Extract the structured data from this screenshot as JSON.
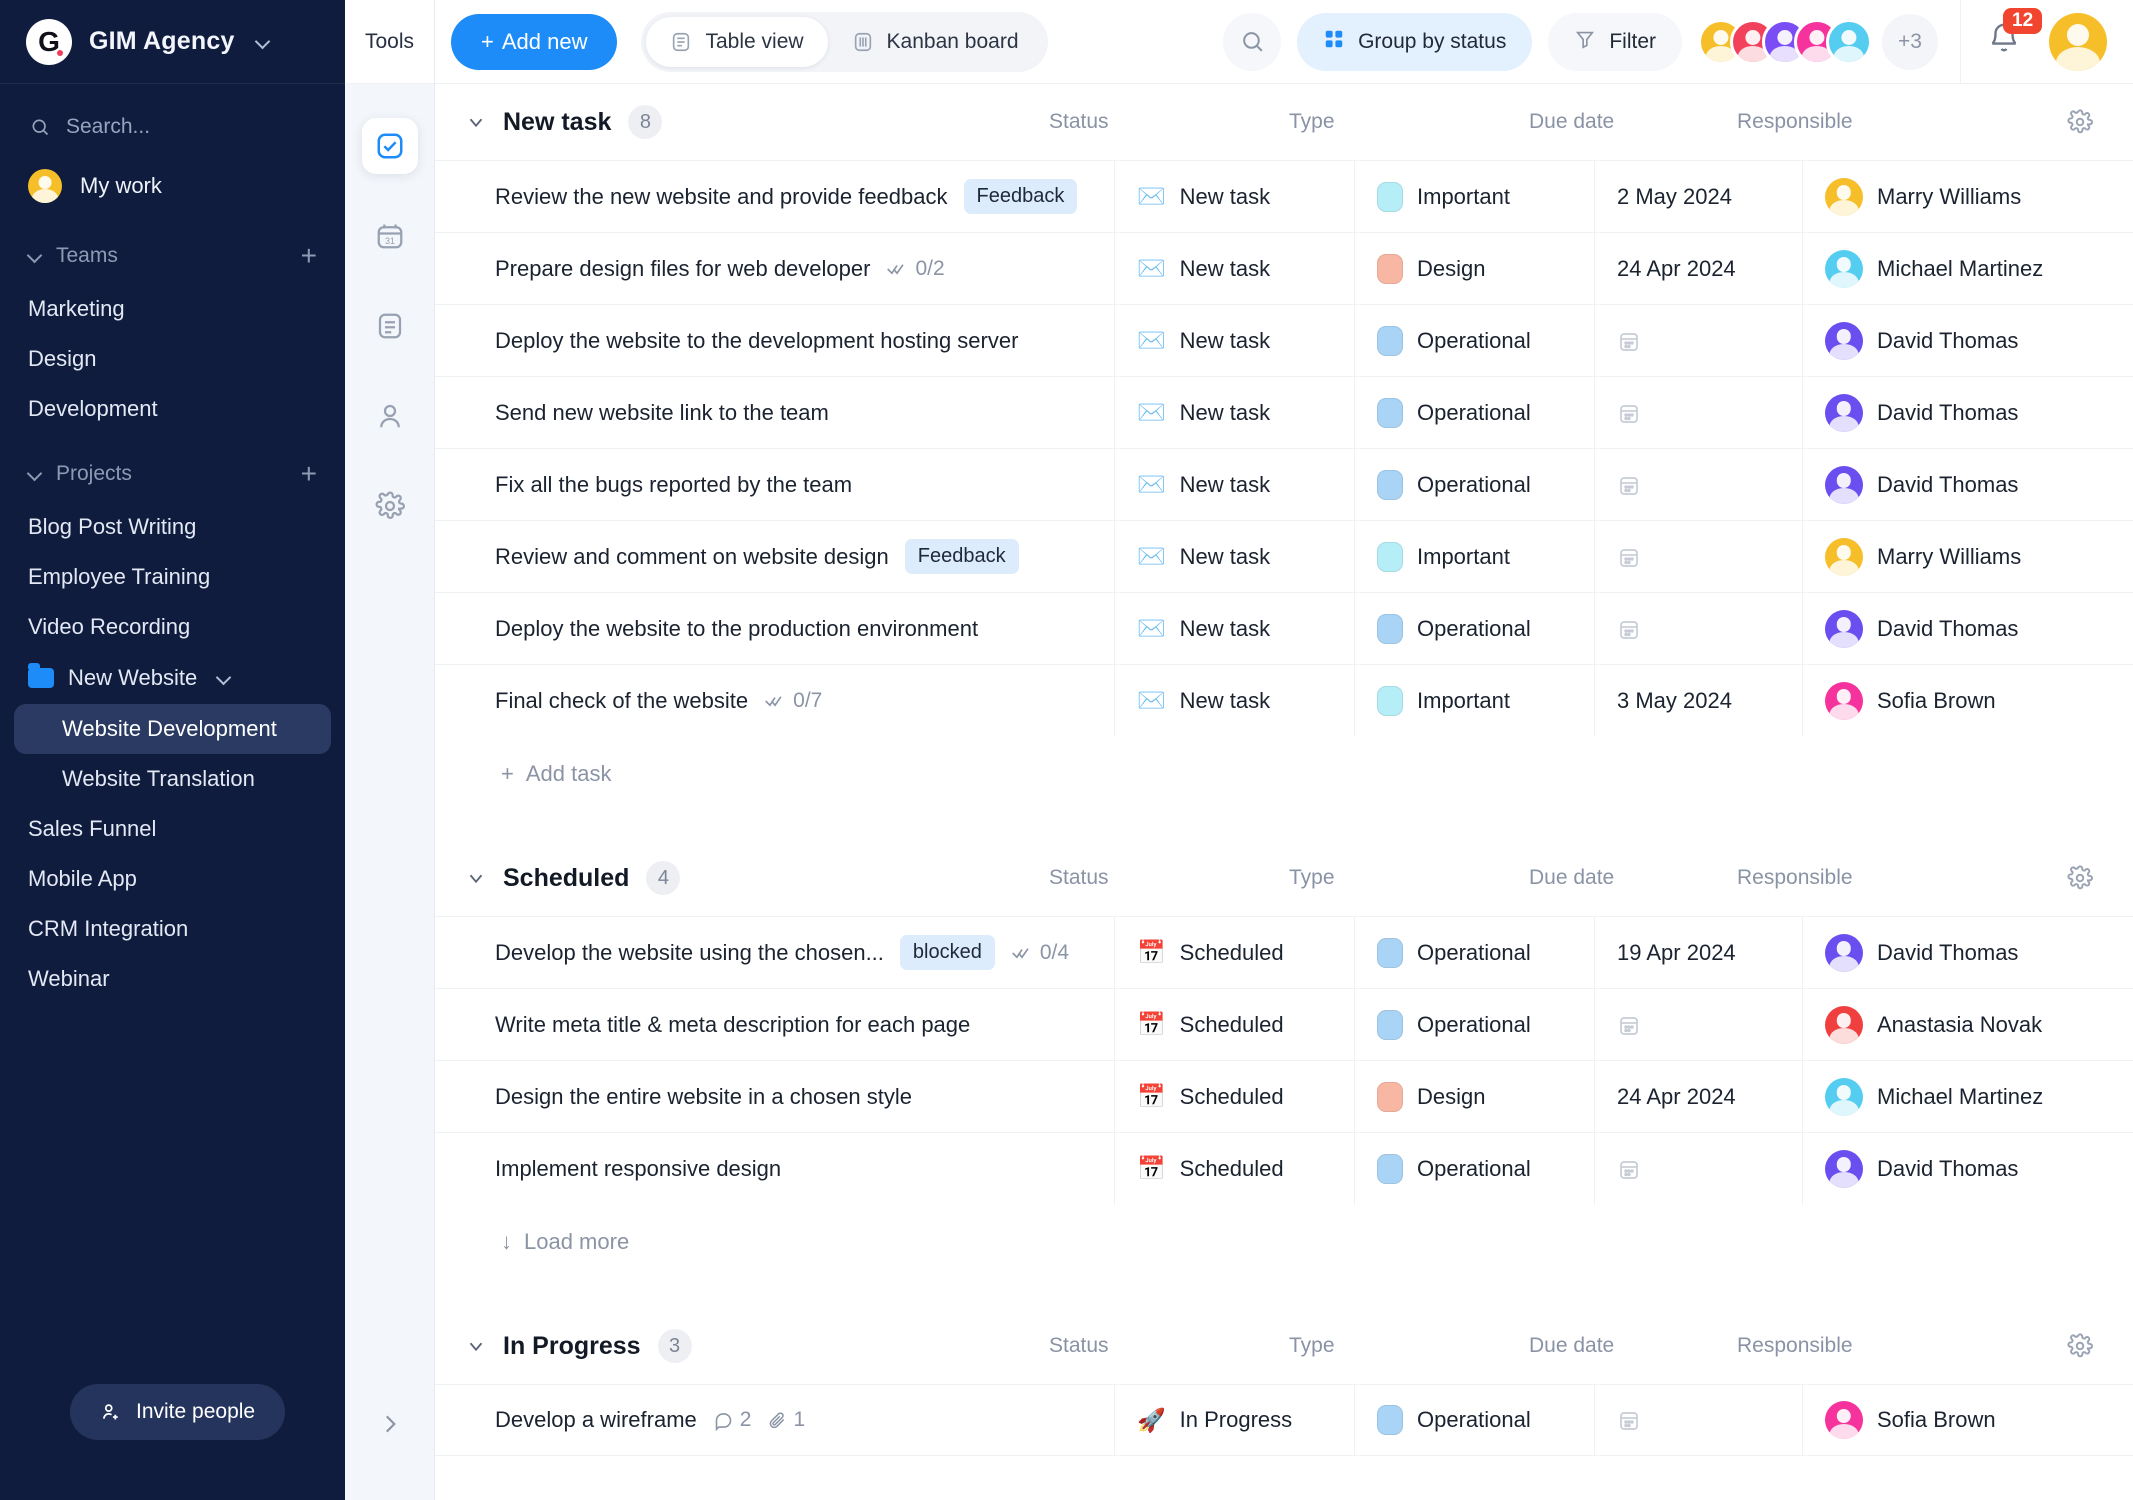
{
  "sidebar": {
    "brand": {
      "name": "GIM Agency",
      "logo_letter": "G"
    },
    "search_placeholder": "Search...",
    "my_work": "My work",
    "sections": [
      {
        "label": "Teams",
        "items": [
          "Marketing",
          "Design",
          "Development"
        ]
      },
      {
        "label": "Projects",
        "items": [
          "Blog Post Writing",
          "Employee Training",
          "Video Recording"
        ]
      }
    ],
    "folder": {
      "label": "New Website"
    },
    "folder_items": [
      {
        "label": "Website Development",
        "active": true
      },
      {
        "label": "Website Translation",
        "active": false
      }
    ],
    "projects_rest": [
      "Sales Funnel",
      "Mobile App",
      "CRM Integration",
      "Webinar"
    ],
    "invite_label": "Invite people"
  },
  "tools": {
    "title": "Tools",
    "icons": [
      "checkbox-icon",
      "calendar-icon",
      "document-icon",
      "person-icon",
      "gear-icon"
    ]
  },
  "toolbar": {
    "add_new": "Add new",
    "table_view": "Table view",
    "kanban_board": "Kanban board",
    "group_by": "Group by status",
    "filter": "Filter",
    "avatars_overflow": "+3",
    "notification_count": "12"
  },
  "columns": {
    "status": "Status",
    "type": "Type",
    "due_date": "Due date",
    "responsible": "Responsible"
  },
  "actions": {
    "add_task": "Add task",
    "load_more": "Load more"
  },
  "type_colors": {
    "Important": "#b5eef7",
    "Design": "#f8b7a2",
    "Operational": "#a9d4f5"
  },
  "avatar_colors": {
    "Marry Williams": "#f6bf2a",
    "Michael Martinez": "#54cdf0",
    "David Thomas": "#6b4ef0",
    "Sofia Brown": "#f6329c",
    "Anastasia Novak": "#f03f3f"
  },
  "groups": [
    {
      "title": "New task",
      "count": "8",
      "footer": "add_task",
      "rows": [
        {
          "name": "Review the new website and provide feedback",
          "tag": "Feedback",
          "subtask": "",
          "comments": "",
          "attachments": "",
          "status": "New task",
          "status_icon": "✉️",
          "type": "Important",
          "due": "2 May 2024",
          "responsible": "Marry Williams"
        },
        {
          "name": "Prepare design files for web developer",
          "tag": "",
          "subtask": "0/2",
          "comments": "",
          "attachments": "",
          "status": "New task",
          "status_icon": "✉️",
          "type": "Design",
          "due": "24 Apr 2024",
          "responsible": "Michael Martinez"
        },
        {
          "name": "Deploy the website to the development hosting server",
          "tag": "",
          "subtask": "",
          "comments": "",
          "attachments": "",
          "status": "New task",
          "status_icon": "✉️",
          "type": "Operational",
          "due": "",
          "responsible": "David Thomas"
        },
        {
          "name": "Send new website link to the team",
          "tag": "",
          "subtask": "",
          "comments": "",
          "attachments": "",
          "status": "New task",
          "status_icon": "✉️",
          "type": "Operational",
          "due": "",
          "responsible": "David Thomas"
        },
        {
          "name": "Fix all the bugs reported by the team",
          "tag": "",
          "subtask": "",
          "comments": "",
          "attachments": "",
          "status": "New task",
          "status_icon": "✉️",
          "type": "Operational",
          "due": "",
          "responsible": "David Thomas"
        },
        {
          "name": "Review and comment on website design",
          "tag": "Feedback",
          "subtask": "",
          "comments": "",
          "attachments": "",
          "status": "New task",
          "status_icon": "✉️",
          "type": "Important",
          "due": "",
          "responsible": "Marry Williams"
        },
        {
          "name": "Deploy the website to the production environment",
          "tag": "",
          "subtask": "",
          "comments": "",
          "attachments": "",
          "status": "New task",
          "status_icon": "✉️",
          "type": "Operational",
          "due": "",
          "responsible": "David Thomas"
        },
        {
          "name": "Final check of the website",
          "tag": "",
          "subtask": "0/7",
          "comments": "",
          "attachments": "",
          "status": "New task",
          "status_icon": "✉️",
          "type": "Important",
          "due": "3 May 2024",
          "responsible": "Sofia Brown"
        }
      ]
    },
    {
      "title": "Scheduled",
      "count": "4",
      "footer": "load_more",
      "rows": [
        {
          "name": "Develop the website using the chosen...",
          "tag": "blocked",
          "subtask": "0/4",
          "comments": "",
          "attachments": "",
          "status": "Scheduled",
          "status_icon": "📅",
          "type": "Operational",
          "due": "19 Apr 2024",
          "responsible": "David Thomas"
        },
        {
          "name": "Write meta title & meta description for each page",
          "tag": "",
          "subtask": "",
          "comments": "",
          "attachments": "",
          "status": "Scheduled",
          "status_icon": "📅",
          "type": "Operational",
          "due": "",
          "responsible": "Anastasia Novak"
        },
        {
          "name": "Design the entire website in a chosen style",
          "tag": "",
          "subtask": "",
          "comments": "",
          "attachments": "",
          "status": "Scheduled",
          "status_icon": "📅",
          "type": "Design",
          "due": "24 Apr 2024",
          "responsible": "Michael Martinez"
        },
        {
          "name": "Implement responsive design",
          "tag": "",
          "subtask": "",
          "comments": "",
          "attachments": "",
          "status": "Scheduled",
          "status_icon": "📅",
          "type": "Operational",
          "due": "",
          "responsible": "David Thomas"
        }
      ]
    },
    {
      "title": "In Progress",
      "count": "3",
      "footer": "",
      "rows": [
        {
          "name": "Develop a wireframe",
          "tag": "",
          "subtask": "",
          "comments": "2",
          "attachments": "1",
          "status": "In Progress",
          "status_icon": "🚀",
          "type": "Operational",
          "due": "",
          "responsible": "Sofia Brown"
        }
      ]
    }
  ]
}
